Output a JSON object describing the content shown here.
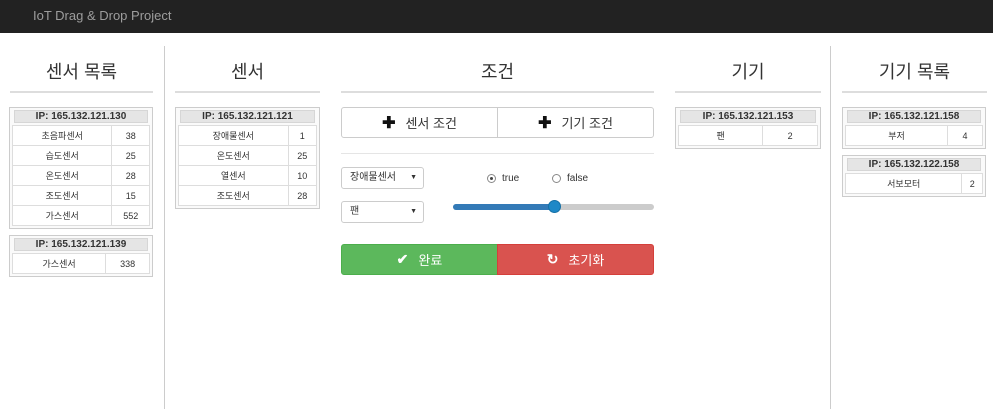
{
  "navbar": {
    "brand": "IoT Drag & Drop Project"
  },
  "columns": {
    "sensor_list": "센서 목록",
    "sensor": "센서",
    "condition": "조건",
    "device": "기기",
    "device_list": "기기 목록"
  },
  "sensor_list": [
    {
      "ip": "IP: 165.132.121.130",
      "rows": [
        {
          "name": "초음파센서",
          "value": "38"
        },
        {
          "name": "습도센서",
          "value": "25"
        },
        {
          "name": "온도센서",
          "value": "28"
        },
        {
          "name": "조도센서",
          "value": "15"
        },
        {
          "name": "가스센서",
          "value": "552"
        }
      ]
    },
    {
      "ip": "IP: 165.132.121.139",
      "rows": [
        {
          "name": "가스센서",
          "value": "338"
        }
      ]
    }
  ],
  "sensor": {
    "ip": "IP: 165.132.121.121",
    "rows": [
      {
        "name": "장애물센서",
        "value": "1"
      },
      {
        "name": "온도센서",
        "value": "25"
      },
      {
        "name": "열센서",
        "value": "10"
      },
      {
        "name": "조도센서",
        "value": "28"
      }
    ]
  },
  "condition": {
    "add_sensor_label": "센서 조건",
    "add_device_label": "기기 조건",
    "sensor_select": "장애물센서",
    "device_select": "팬",
    "radio_true": "true",
    "radio_false": "false",
    "radio_selected": "true",
    "slider_value": 0.5,
    "done_label": "완료",
    "reset_label": "초기화"
  },
  "device": {
    "ip": "IP: 165.132.121.153",
    "rows": [
      {
        "name": "팬",
        "value": "2"
      }
    ]
  },
  "device_list": [
    {
      "ip": "IP: 165.132.121.158",
      "rows": [
        {
          "name": "부저",
          "value": "4"
        }
      ]
    },
    {
      "ip": "IP: 165.132.122.158",
      "rows": [
        {
          "name": "서보모터",
          "value": "2"
        }
      ]
    }
  ],
  "colors": {
    "navbar": "#222222",
    "success": "#5cb85c",
    "danger": "#d9534f",
    "slider": "#337ab7"
  },
  "icons": {
    "add": "plus-icon",
    "done": "check-icon",
    "reset": "refresh-icon",
    "select": "caret-down-icon"
  }
}
